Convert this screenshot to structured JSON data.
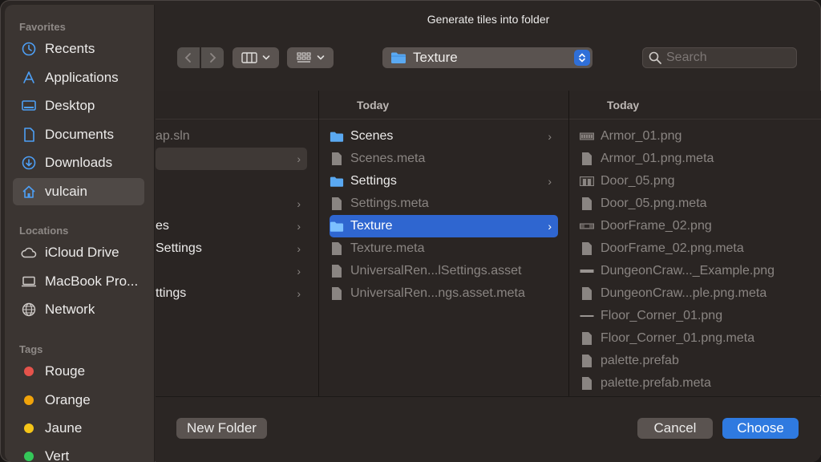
{
  "dialog": {
    "title": "Generate tiles into folder"
  },
  "sidebar": {
    "favorites_label": "Favorites",
    "favorites": [
      {
        "label": "Recents",
        "icon": "clock-icon"
      },
      {
        "label": "Applications",
        "icon": "applications-icon"
      },
      {
        "label": "Desktop",
        "icon": "desktop-icon"
      },
      {
        "label": "Documents",
        "icon": "document-icon"
      },
      {
        "label": "Downloads",
        "icon": "download-icon"
      },
      {
        "label": "vulcain",
        "icon": "home-icon"
      }
    ],
    "locations_label": "Locations",
    "locations": [
      {
        "label": "iCloud Drive",
        "icon": "cloud-icon"
      },
      {
        "label": "MacBook Pro...",
        "icon": "laptop-icon"
      },
      {
        "label": "Network",
        "icon": "globe-icon"
      }
    ],
    "tags_label": "Tags",
    "tags": [
      {
        "label": "Rouge",
        "color": "#e5534b"
      },
      {
        "label": "Orange",
        "color": "#f0a30a"
      },
      {
        "label": "Jaune",
        "color": "#f5c518"
      },
      {
        "label": "Vert",
        "color": "#34c759"
      }
    ]
  },
  "toolbar": {
    "back_icon": "chevron-left-icon",
    "forward_icon": "chevron-right-icon",
    "view_columns_icon": "columns-icon",
    "view_grid_icon": "grid-icon",
    "path_label": "Texture",
    "search_placeholder": "Search"
  },
  "columns": {
    "col1": {
      "rows": [
        {
          "name": "ap.sln"
        },
        {
          "name": ""
        },
        {
          "name": ""
        },
        {
          "name": "es"
        },
        {
          "name": "Settings"
        },
        {
          "name": ""
        },
        {
          "name": "ttings"
        }
      ]
    },
    "col2": {
      "header": "Today",
      "rows": [
        {
          "name": "Scenes",
          "type": "folder"
        },
        {
          "name": "Scenes.meta",
          "type": "file"
        },
        {
          "name": "Settings",
          "type": "folder"
        },
        {
          "name": "Settings.meta",
          "type": "file"
        },
        {
          "name": "Texture",
          "type": "folder",
          "selected": true
        },
        {
          "name": "Texture.meta",
          "type": "file"
        },
        {
          "name": "UniversalRen...lSettings.asset",
          "type": "file"
        },
        {
          "name": "UniversalRen...ngs.asset.meta",
          "type": "file"
        }
      ]
    },
    "col3": {
      "header": "Today",
      "rows": [
        {
          "name": "Armor_01.png",
          "type": "image"
        },
        {
          "name": "Armor_01.png.meta",
          "type": "file"
        },
        {
          "name": "Door_05.png",
          "type": "image"
        },
        {
          "name": "Door_05.png.meta",
          "type": "file"
        },
        {
          "name": "DoorFrame_02.png",
          "type": "image"
        },
        {
          "name": "DoorFrame_02.png.meta",
          "type": "file"
        },
        {
          "name": "DungeonCraw..._Example.png",
          "type": "image"
        },
        {
          "name": "DungeonCraw...ple.png.meta",
          "type": "file"
        },
        {
          "name": "Floor_Corner_01.png",
          "type": "image"
        },
        {
          "name": "Floor_Corner_01.png.meta",
          "type": "file"
        },
        {
          "name": "palette.prefab",
          "type": "file"
        },
        {
          "name": "palette.prefab.meta",
          "type": "file"
        }
      ]
    }
  },
  "footer": {
    "new_folder_label": "New Folder",
    "cancel_label": "Cancel",
    "choose_label": "Choose"
  }
}
